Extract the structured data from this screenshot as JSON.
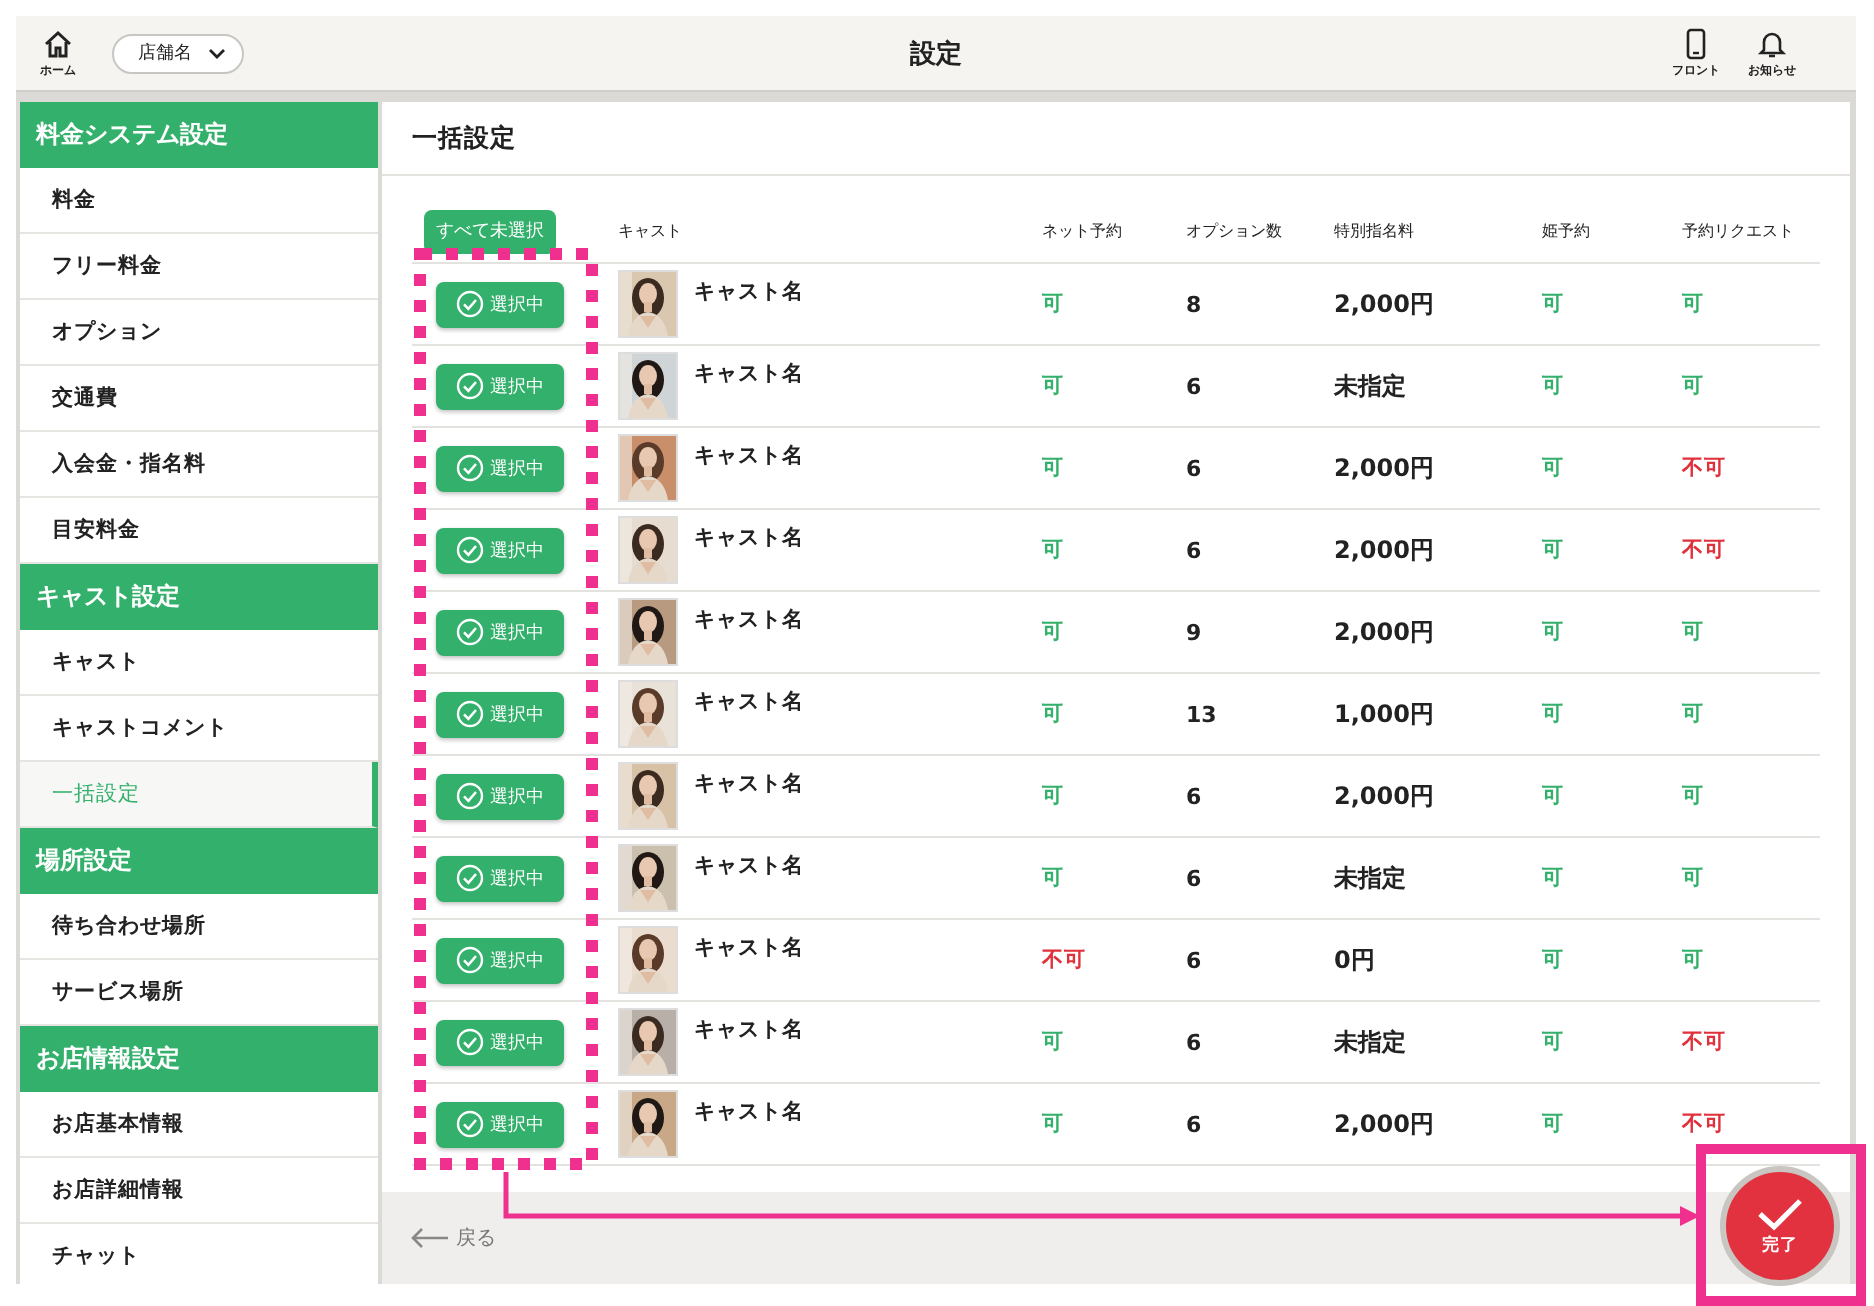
{
  "header": {
    "home_label": "ホーム",
    "store_select": "店舗名",
    "title": "設定",
    "actions": [
      {
        "kind": "phone",
        "label": "フロント"
      },
      {
        "kind": "bell",
        "label": "お知らせ"
      }
    ]
  },
  "sidebar": [
    {
      "title": "料金システム設定",
      "items": [
        {
          "label": "料金",
          "selected": false
        },
        {
          "label": "フリー料金",
          "selected": false
        },
        {
          "label": "オプション",
          "selected": false
        },
        {
          "label": "交通費",
          "selected": false
        },
        {
          "label": "入会金・指名料",
          "selected": false
        },
        {
          "label": "目安料金",
          "selected": false
        }
      ]
    },
    {
      "title": "キャスト設定",
      "items": [
        {
          "label": "キャスト",
          "selected": false
        },
        {
          "label": "キャストコメント",
          "selected": false
        },
        {
          "label": "一括設定",
          "selected": true
        }
      ]
    },
    {
      "title": "場所設定",
      "items": [
        {
          "label": "待ち合わせ場所",
          "selected": false
        },
        {
          "label": "サービス場所",
          "selected": false
        }
      ]
    },
    {
      "title": "お店情報設定",
      "items": [
        {
          "label": "お店基本情報",
          "selected": false
        },
        {
          "label": "お店詳細情報",
          "selected": false
        },
        {
          "label": "チャット",
          "selected": false
        }
      ]
    }
  ],
  "main": {
    "title": "一括設定",
    "select_all_button": "すべて未選択",
    "columns": [
      "キャスト",
      "ネット予約",
      "オプション数",
      "特別指名料",
      "姫予約",
      "予約リクエスト"
    ],
    "rows": [
      {
        "selected": true,
        "select_label": "選択中",
        "name": "キャスト名",
        "net": {
          "text": "可",
          "allowed": true
        },
        "options": "8",
        "fee": "2,000円",
        "hime": {
          "text": "可",
          "allowed": true
        },
        "request": {
          "text": "可",
          "allowed": true
        }
      },
      {
        "selected": true,
        "select_label": "選択中",
        "name": "キャスト名",
        "net": {
          "text": "可",
          "allowed": true
        },
        "options": "6",
        "fee": "未指定",
        "hime": {
          "text": "可",
          "allowed": true
        },
        "request": {
          "text": "可",
          "allowed": true
        }
      },
      {
        "selected": true,
        "select_label": "選択中",
        "name": "キャスト名",
        "net": {
          "text": "可",
          "allowed": true
        },
        "options": "6",
        "fee": "2,000円",
        "hime": {
          "text": "可",
          "allowed": true
        },
        "request": {
          "text": "不可",
          "allowed": false
        }
      },
      {
        "selected": true,
        "select_label": "選択中",
        "name": "キャスト名",
        "net": {
          "text": "可",
          "allowed": true
        },
        "options": "6",
        "fee": "2,000円",
        "hime": {
          "text": "可",
          "allowed": true
        },
        "request": {
          "text": "不可",
          "allowed": false
        }
      },
      {
        "selected": true,
        "select_label": "選択中",
        "name": "キャスト名",
        "net": {
          "text": "可",
          "allowed": true
        },
        "options": "9",
        "fee": "2,000円",
        "hime": {
          "text": "可",
          "allowed": true
        },
        "request": {
          "text": "可",
          "allowed": true
        }
      },
      {
        "selected": true,
        "select_label": "選択中",
        "name": "キャスト名",
        "net": {
          "text": "可",
          "allowed": true
        },
        "options": "13",
        "fee": "1,000円",
        "hime": {
          "text": "可",
          "allowed": true
        },
        "request": {
          "text": "可",
          "allowed": true
        }
      },
      {
        "selected": true,
        "select_label": "選択中",
        "name": "キャスト名",
        "net": {
          "text": "可",
          "allowed": true
        },
        "options": "6",
        "fee": "2,000円",
        "hime": {
          "text": "可",
          "allowed": true
        },
        "request": {
          "text": "可",
          "allowed": true
        }
      },
      {
        "selected": true,
        "select_label": "選択中",
        "name": "キャスト名",
        "net": {
          "text": "可",
          "allowed": true
        },
        "options": "6",
        "fee": "未指定",
        "hime": {
          "text": "可",
          "allowed": true
        },
        "request": {
          "text": "可",
          "allowed": true
        }
      },
      {
        "selected": true,
        "select_label": "選択中",
        "name": "キャスト名",
        "net": {
          "text": "不可",
          "allowed": false
        },
        "options": "6",
        "fee": "0円",
        "hime": {
          "text": "可",
          "allowed": true
        },
        "request": {
          "text": "可",
          "allowed": true
        }
      },
      {
        "selected": true,
        "select_label": "選択中",
        "name": "キャスト名",
        "net": {
          "text": "可",
          "allowed": true
        },
        "options": "6",
        "fee": "未指定",
        "hime": {
          "text": "可",
          "allowed": true
        },
        "request": {
          "text": "不可",
          "allowed": false
        }
      },
      {
        "selected": true,
        "select_label": "選択中",
        "name": "キャスト名",
        "net": {
          "text": "可",
          "allowed": true
        },
        "options": "6",
        "fee": "2,000円",
        "hime": {
          "text": "可",
          "allowed": true
        },
        "request": {
          "text": "不可",
          "allowed": false
        }
      }
    ],
    "back_link": "戻る",
    "done_button": "完了"
  }
}
